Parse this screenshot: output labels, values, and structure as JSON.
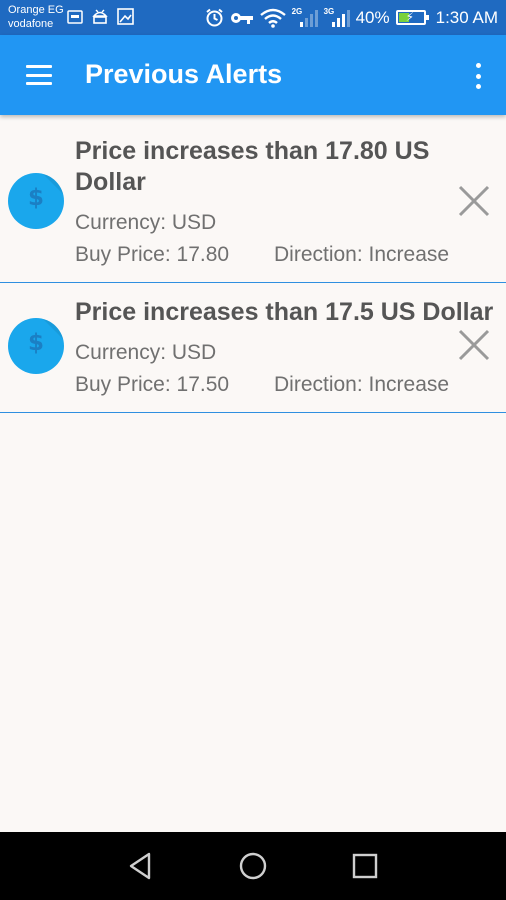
{
  "status_bar": {
    "carrier_1": "Orange EG",
    "carrier_2": "vodafone",
    "network_1": "2G",
    "network_2": "3G",
    "battery_percent": "40%",
    "time": "1:30 AM",
    "icons": [
      "ftp-icon",
      "android-icon",
      "image-icon",
      "alarm-icon",
      "key-icon",
      "wifi-icon",
      "signal-icon",
      "battery-charging-icon"
    ]
  },
  "app_bar": {
    "title": "Previous Alerts",
    "menu_icon": "hamburger-menu-icon",
    "overflow_icon": "more-vert-icon"
  },
  "alerts": [
    {
      "title": "Price increases than 17.80 US Dollar",
      "currency": "Currency: USD",
      "buy_price": "Buy Price: 17.80",
      "direction": "Direction: Increase",
      "icon": "dollar-coin-icon",
      "delete_icon": "close-icon"
    },
    {
      "title": "Price increases than 17.5 US Dollar",
      "currency": "Currency: USD",
      "buy_price": "Buy Price: 17.50",
      "direction": "Direction: Increase",
      "icon": "dollar-coin-icon",
      "delete_icon": "close-icon"
    }
  ],
  "nav_bar": {
    "icons": [
      "back-icon",
      "home-icon",
      "recents-icon"
    ]
  },
  "colors": {
    "app_bar": "#2196f3",
    "status_bar": "#1f6ac1",
    "divider": "#2f8fe0",
    "background": "#fbf8f6",
    "coin": "#1aa7ec"
  }
}
